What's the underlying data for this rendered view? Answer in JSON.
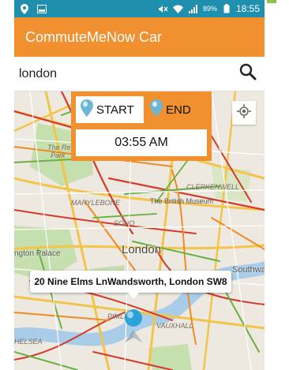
{
  "status_bar": {
    "battery": "89%",
    "time": "18:55",
    "icons": [
      "location-icon",
      "image-icon",
      "mute-icon",
      "wifi-icon",
      "signal-icon",
      "battery-icon"
    ]
  },
  "app_bar": {
    "title": "CommuteMeNow Car"
  },
  "search": {
    "value": "london",
    "icon": "search-icon"
  },
  "controls": {
    "start_label": "START",
    "end_label": "END",
    "time": "03:55 AM",
    "locate_icon": "my-location-icon"
  },
  "map": {
    "labels": {
      "the_regents": "The Re",
      "park": "Park",
      "marylebone": "MARYLEBONE",
      "british_museum": "The British Museum",
      "clerkenwell": "CLERKENWELL",
      "soho": "SOHO",
      "palace": "ngton Palace",
      "city": "London",
      "southwark": "Southwar",
      "pimlico": "PIMLI",
      "vauxhall": "VAUXHALL",
      "chelsea": "HELSEA"
    },
    "info_window": "20 Nine Elms LnWandsworth, London SW8"
  },
  "colors": {
    "status_bar": "#1f8fae",
    "app_bar": "#f0902e",
    "accent": "#f0902e",
    "marker": "#2ba3d9"
  }
}
